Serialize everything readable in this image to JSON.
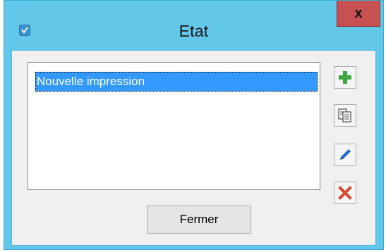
{
  "window": {
    "title": "Etat",
    "close_label": "x"
  },
  "list": {
    "items": [
      {
        "label": "Nouvelle impression",
        "selected": true
      }
    ]
  },
  "toolbar": {
    "buttons": [
      {
        "icon": "add-icon",
        "color": "#3aa83a"
      },
      {
        "icon": "copy-icon",
        "color": "#4a4a4a"
      },
      {
        "icon": "edit-icon",
        "color": "#1f6fd1"
      },
      {
        "icon": "delete-icon",
        "color": "#d9452e"
      }
    ]
  },
  "footer": {
    "close_button_label": "Fermer"
  },
  "colors": {
    "titlebar": "#63c7ea",
    "close_button": "#c75050",
    "selection": "#3399ff"
  }
}
